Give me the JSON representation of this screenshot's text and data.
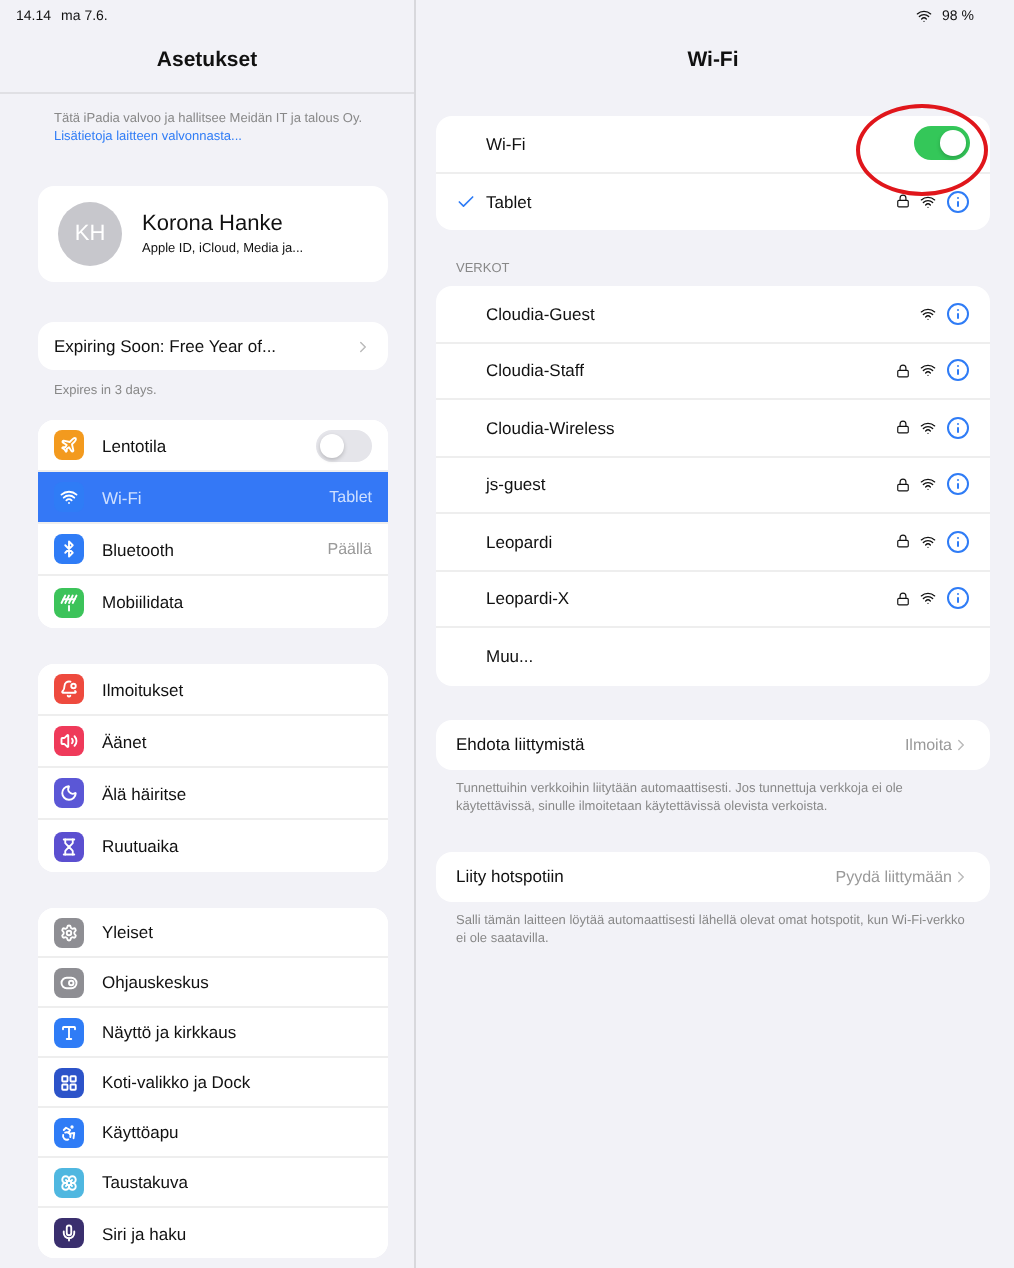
{
  "status_bar": {
    "time": "14.14",
    "date": "ma 7.6.",
    "battery": "98 %"
  },
  "sidebar": {
    "title": "Asetukset",
    "supervision": {
      "text": "Tätä iPadia valvoo ja hallitsee Meidän IT ja talous Oy.",
      "link": "Lisätietoja laitteen valvonnasta..."
    },
    "profile": {
      "initials": "KH",
      "name": "Korona Hanke",
      "subtitle": "Apple ID, iCloud, Media ja..."
    },
    "offer": {
      "label": "Expiring Soon: Free Year of...",
      "note": "Expires in 3 days."
    },
    "groups": [
      [
        {
          "label": "Lentotila",
          "color": "#f39a1e",
          "kind": "toggle",
          "on": false,
          "selected": false
        },
        {
          "label": "Wi-Fi",
          "color": "#2f7cf6",
          "kind": "value",
          "value": "Tablet",
          "selected": true
        },
        {
          "label": "Bluetooth",
          "color": "#2f7cf6",
          "kind": "value",
          "value": "Päällä",
          "selected": false
        },
        {
          "label": "Mobiilidata",
          "color": "#3cc35a",
          "kind": "plain",
          "selected": false
        }
      ],
      [
        {
          "label": "Ilmoitukset",
          "color": "#ee4a3e",
          "kind": "plain",
          "selected": false
        },
        {
          "label": "Äänet",
          "color": "#ef3a5a",
          "kind": "plain",
          "selected": false
        },
        {
          "label": "Älä häiritse",
          "color": "#5b57d6",
          "kind": "plain",
          "selected": false
        },
        {
          "label": "Ruutuaika",
          "color": "#5b4fd0",
          "kind": "plain",
          "selected": false
        }
      ],
      [
        {
          "label": "Yleiset",
          "color": "#8e8e93",
          "kind": "plain",
          "selected": false
        },
        {
          "label": "Ohjauskeskus",
          "color": "#8e8e93",
          "kind": "plain",
          "selected": false
        },
        {
          "label": "Näyttö ja kirkkaus",
          "color": "#2f7cf6",
          "kind": "plain",
          "selected": false
        },
        {
          "label": "Koti-valikko ja Dock",
          "color": "#2c53c9",
          "kind": "plain",
          "selected": false
        },
        {
          "label": "Käyttöapu",
          "color": "#2f7cf6",
          "kind": "plain",
          "selected": false
        },
        {
          "label": "Taustakuva",
          "color": "#4fb7e0",
          "kind": "plain",
          "selected": false
        },
        {
          "label": "Siri ja haku",
          "color": "#3a2f6e",
          "kind": "plain",
          "selected": false
        }
      ]
    ]
  },
  "detail": {
    "title": "Wi-Fi",
    "wifi": {
      "label": "Wi-Fi",
      "on": true
    },
    "current": {
      "name": "Tablet",
      "checked": true,
      "locked": true
    },
    "section": "VERKOT",
    "networks": [
      {
        "name": "Cloudia-Guest",
        "kind": "network",
        "locked": false
      },
      {
        "name": "Cloudia-Staff",
        "kind": "network",
        "locked": true
      },
      {
        "name": "Cloudia-Wireless",
        "kind": "network",
        "locked": true
      },
      {
        "name": "js-guest",
        "kind": "network",
        "locked": true
      },
      {
        "name": "Leopardi",
        "kind": "network",
        "locked": true
      },
      {
        "name": "Leopardi-X",
        "kind": "network",
        "locked": true
      },
      {
        "name": "Muu...",
        "kind": "other"
      }
    ],
    "options": [
      {
        "label": "Ehdota liittymistä",
        "value": "Ilmoita",
        "note": "Tunnettuihin verkkoihin liitytään automaattisesti. Jos tunnettuja verkkoja ei ole käytettävissä, sinulle ilmoitetaan käytettävissä olevista verkoista."
      },
      {
        "label": "Liity hotspotiin",
        "value": "Pyydä liittymään",
        "note": "Salli tämän laitteen löytää automaattisesti lähellä olevat omat hotspotit, kun Wi-Fi-verkko ei ole saatavilla."
      }
    ]
  }
}
